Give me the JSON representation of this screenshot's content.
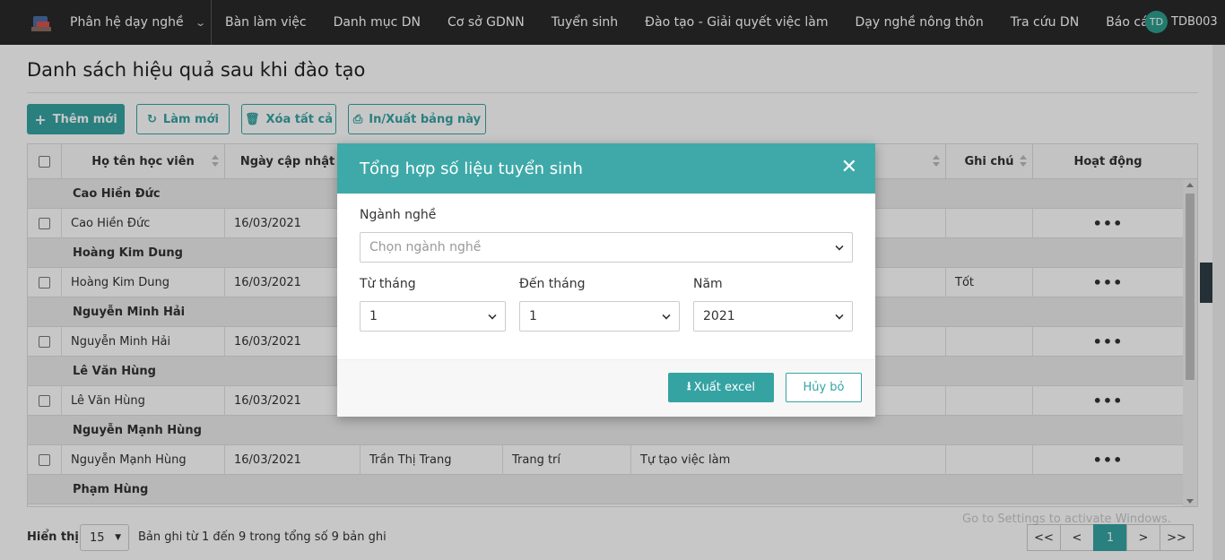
{
  "nav": {
    "module": "Phân hệ dạy nghề",
    "menu": [
      "Bàn làm việc",
      "Danh mục DN",
      "Cơ sở GDNN",
      "Tuyển sinh",
      "Đào tạo - Giải quyết việc làm",
      "Dạy nghề nông thôn",
      "Tra cứu DN",
      "Báo cáo"
    ],
    "user_initials": "TD",
    "user_name": "TDB003"
  },
  "page": {
    "title": "Danh sách hiệu quả sau khi đào tạo",
    "buttons": {
      "add": "Thêm mới",
      "refresh": "Làm mới",
      "delete_all": "Xóa tất cả",
      "print": "In/Xuất bảng này"
    }
  },
  "table": {
    "headers": {
      "name": "Họ tên học viên",
      "date": "Ngày cập nhật",
      "note": "Ghi chú",
      "action": "Hoạt động"
    },
    "action_glyph": "•••",
    "groups": [
      {
        "group": "Cao Hiền Đức",
        "name": "Cao Hiền Đức",
        "date": "16/03/2021",
        "teacher": "",
        "trade": "",
        "result": "",
        "note": ""
      },
      {
        "group": "Hoàng Kim Dung",
        "name": "Hoàng Kim Dung",
        "date": "16/03/2021",
        "teacher": "",
        "trade": "",
        "result": "",
        "note": "Tốt"
      },
      {
        "group": "Nguyễn Minh Hải",
        "name": "Nguyễn Minh Hải",
        "date": "16/03/2021",
        "teacher": "",
        "trade": "",
        "result": "",
        "note": ""
      },
      {
        "group": "Lê Văn Hùng",
        "name": "Lê Văn Hùng",
        "date": "16/03/2021",
        "teacher": "",
        "trade": "",
        "result": "",
        "note": ""
      },
      {
        "group": "Nguyễn Mạnh Hùng",
        "name": "Nguyễn Mạnh Hùng",
        "date": "16/03/2021",
        "teacher": "Trần Thị Trang",
        "trade": "Trang trí",
        "result": "Tự tạo việc làm",
        "note": ""
      }
    ],
    "last_group": "Phạm Hùng"
  },
  "footer": {
    "show_label": "Hiển thị",
    "page_size": "15",
    "record_info": "Bản ghi từ 1 đến 9 trong tổng số 9 bản ghi",
    "pager": [
      "<<",
      "<",
      "1",
      ">",
      ">>"
    ]
  },
  "watermark": "Go to Settings to activate Windows.",
  "modal": {
    "title": "Tổng hợp số liệu tuyển sinh",
    "close_glyph": "✕",
    "trade_label": "Ngành nghề",
    "trade_placeholder": "Chọn ngành nghề",
    "from_label": "Từ tháng",
    "from_value": "1",
    "to_label": "Đến tháng",
    "to_value": "1",
    "year_label": "Năm",
    "year_value": "2021",
    "export_label": "Xuất excel",
    "cancel_label": "Hủy bỏ"
  },
  "colors": {
    "accent": "#36a3a3",
    "modal_header": "#3fa9a9",
    "navbar": "#2a2a2a"
  }
}
